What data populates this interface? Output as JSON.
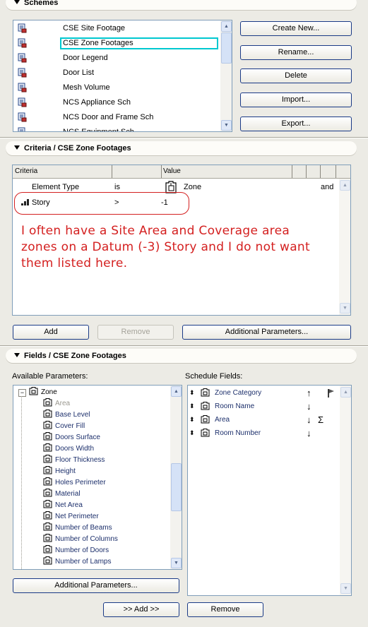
{
  "schemes": {
    "heading": "Schemes",
    "items": [
      "CSE Site Footage",
      "CSE Zone Footages",
      "Door Legend",
      "Door List",
      "Mesh Volume",
      "NCS Appliance Sch",
      "NCS Door and Frame Sch",
      "NCS Equipment Sch"
    ],
    "buttons": {
      "create_new": "Create New...",
      "rename": "Rename...",
      "delete": "Delete",
      "import": "Import...",
      "export": "Export..."
    }
  },
  "criteria": {
    "heading": "Criteria /  CSE Zone Footages",
    "columns": {
      "criteria": "Criteria",
      "value": "Value"
    },
    "rows": [
      {
        "criteria": "Element Type",
        "operator": "is",
        "value": "Zone",
        "link": "and"
      },
      {
        "criteria": "Story",
        "operator": ">",
        "value": "-1",
        "link": ""
      }
    ],
    "annotation": "I often have a Site Area and Coverage area zones on a Datum (-3) Story and I do not want them listed here.",
    "buttons": {
      "add": "Add",
      "remove": "Remove",
      "additional": "Additional Parameters..."
    },
    "colors": {
      "annotation": "#d42020",
      "highlight": "#00c8d0"
    }
  },
  "fields": {
    "heading": "Fields /  CSE Zone Footages",
    "available_label": "Available Parameters:",
    "schedule_label": "Schedule Fields:",
    "tree_root": "Zone",
    "available": [
      "Area",
      "Base Level",
      "Cover Fill",
      "Doors Surface",
      "Doors Width",
      "Floor Thickness",
      "Height",
      "Holes Perimeter",
      "Material",
      "Net Area",
      "Net Perimeter",
      "Number of Beams",
      "Number of Columns",
      "Number of Doors",
      "Number of Lamps"
    ],
    "schedule": [
      {
        "name": "Zone Category",
        "sort": "↑",
        "extra": "flag"
      },
      {
        "name": "Room Name",
        "sort": "↓",
        "extra": ""
      },
      {
        "name": "Area",
        "sort": "↓",
        "extra": "Σ"
      },
      {
        "name": "Room Number",
        "sort": "↓",
        "extra": ""
      }
    ],
    "buttons": {
      "additional": "Additional Parameters...",
      "add": ">> Add >>",
      "remove": "Remove"
    }
  }
}
